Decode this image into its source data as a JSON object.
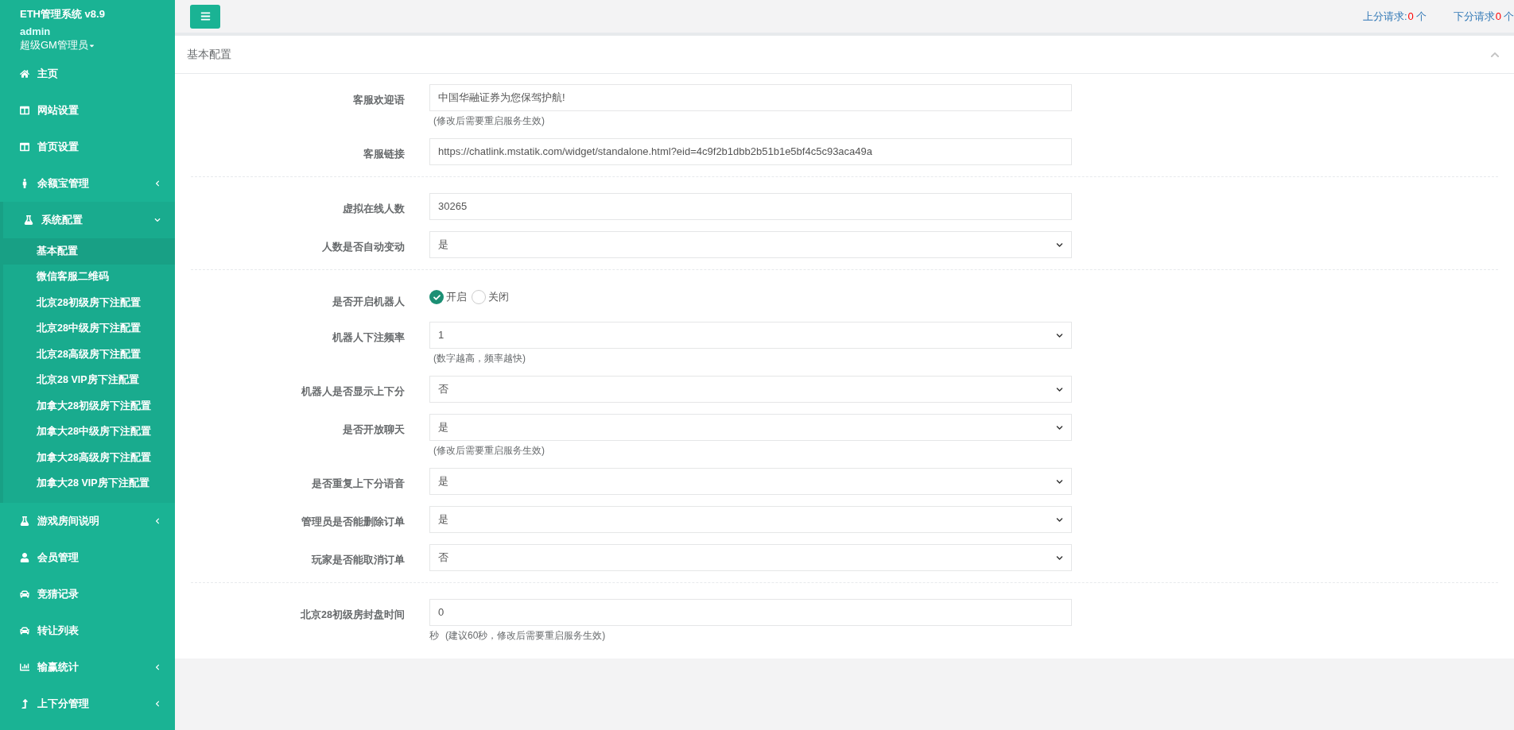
{
  "sidebar": {
    "app_title": "ETH管理系统 v8.9",
    "user_name": "admin",
    "user_role": "超级GM管理员",
    "items": [
      {
        "label": "主页"
      },
      {
        "label": "网站设置"
      },
      {
        "label": "首页设置"
      },
      {
        "label": "余额宝管理",
        "expanded": false
      },
      {
        "label": "系统配置",
        "expanded": true,
        "children": [
          {
            "label": "基本配置",
            "selected": true
          },
          {
            "label": "微信客服二维码",
            "selected": false
          },
          {
            "label": "北京28初级房下注配置",
            "selected": false
          },
          {
            "label": "北京28中级房下注配置",
            "selected": false
          },
          {
            "label": "北京28高级房下注配置",
            "selected": false
          },
          {
            "label": "北京28 VIP房下注配置",
            "selected": false
          },
          {
            "label": "加拿大28初级房下注配置",
            "selected": false
          },
          {
            "label": "加拿大28中级房下注配置",
            "selected": false
          },
          {
            "label": "加拿大28高级房下注配置",
            "selected": false
          },
          {
            "label": "加拿大28 VIP房下注配置",
            "selected": false
          }
        ]
      },
      {
        "label": "游戏房间说明",
        "expanded": false
      },
      {
        "label": "会员管理"
      },
      {
        "label": "竞猜记录"
      },
      {
        "label": "转让列表"
      },
      {
        "label": "输赢统计",
        "expanded": false
      },
      {
        "label": "上下分管理",
        "expanded": false
      }
    ]
  },
  "top_bar": {
    "requests": [
      {
        "label": "上分请求:",
        "count": "0",
        "unit": "个"
      },
      {
        "label": "下分请求",
        "count": "0",
        "unit": "个"
      }
    ]
  },
  "panel": {
    "title": "基本配置",
    "sections": [
      {
        "fields": [
          {
            "kind": "text",
            "label": "客服欢迎语",
            "value": "中国华融证券为您保驾护航!",
            "note": "(修改后需要重启服务生效)"
          },
          {
            "kind": "text",
            "label": "客服链接",
            "value": "https://chatlink.mstatik.com/widget/standalone.html?eid=4c9f2b1dbb2b51b1e5bf4c5c93aca49a"
          }
        ]
      },
      {
        "fields": [
          {
            "kind": "text",
            "label": "虚拟在线人数",
            "value": "30265"
          },
          {
            "kind": "select",
            "label": "人数是否自动变动",
            "value": "是"
          }
        ]
      },
      {
        "fields": [
          {
            "kind": "radio",
            "label": "是否开启机器人",
            "options": [
              {
                "label": "开启",
                "selected": true
              },
              {
                "label": "关闭",
                "selected": false
              }
            ]
          },
          {
            "kind": "select",
            "label": "机器人下注频率",
            "value": "1",
            "note": "(数字越高，频率越快)"
          },
          {
            "kind": "select",
            "label": "机器人是否显示上下分",
            "value": "否"
          },
          {
            "kind": "select",
            "label": "是否开放聊天",
            "value": "是",
            "note": "(修改后需要重启服务生效)"
          },
          {
            "kind": "select",
            "label": "是否重复上下分语音",
            "value": "是"
          },
          {
            "kind": "select",
            "label": "管理员是否能删除订单",
            "value": "是"
          },
          {
            "kind": "select",
            "label": "玩家是否能取消订单",
            "value": "否"
          }
        ]
      },
      {
        "fields": [
          {
            "kind": "text",
            "label": "北京28初级房封盘时间",
            "value": "0",
            "unit": "秒",
            "note": "(建议60秒，修改后需要重启服务生效)"
          }
        ]
      }
    ]
  }
}
